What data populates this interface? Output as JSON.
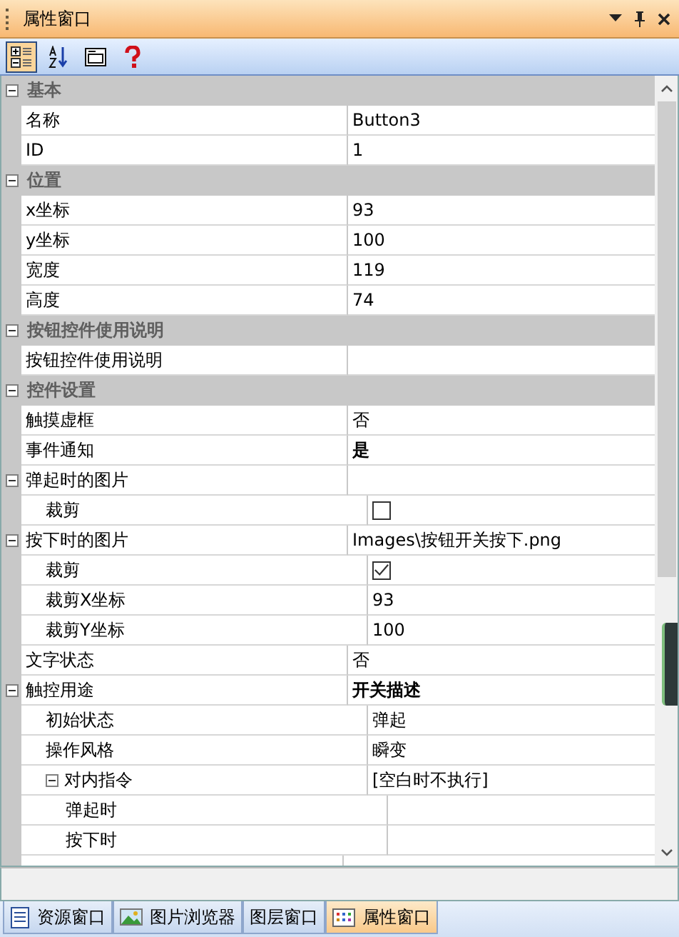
{
  "window": {
    "title": "属性窗口"
  },
  "toolbar": [
    {
      "kind": "categorized",
      "selected": true
    },
    {
      "kind": "alphabetical",
      "selected": false
    },
    {
      "kind": "pages",
      "selected": false
    },
    {
      "kind": "help",
      "selected": false
    }
  ],
  "grid": [
    {
      "kind": "category",
      "label": "基本",
      "expanded": true,
      "children": [
        {
          "kind": "text",
          "name": "名称",
          "value": "Button3"
        },
        {
          "kind": "text",
          "name": "ID",
          "value": "1"
        }
      ]
    },
    {
      "kind": "category",
      "label": "位置",
      "expanded": true,
      "children": [
        {
          "kind": "text",
          "name": "x坐标",
          "value": "93"
        },
        {
          "kind": "text",
          "name": "y坐标",
          "value": "100"
        },
        {
          "kind": "text",
          "name": "宽度",
          "value": "119"
        },
        {
          "kind": "text",
          "name": "高度",
          "value": "74"
        }
      ]
    },
    {
      "kind": "category",
      "label": "按钮控件使用说明",
      "expanded": true,
      "children": [
        {
          "kind": "text",
          "name": "按钮控件使用说明"
        }
      ]
    },
    {
      "kind": "category",
      "label": "控件设置",
      "expanded": true,
      "children": [
        {
          "kind": "text",
          "name": "触摸虚框",
          "value": "否"
        },
        {
          "kind": "text",
          "name": "事件通知",
          "value": "是",
          "bold": true
        },
        {
          "kind": "text",
          "name": "弹起时的图片",
          "expanded": true,
          "children": [
            {
              "kind": "checkbox",
              "name": "裁剪",
              "checked": false
            }
          ]
        },
        {
          "kind": "text",
          "name": "按下时的图片",
          "value": "Images\\按钮开关按下.png",
          "expanded": true,
          "children": [
            {
              "kind": "checkbox",
              "name": "裁剪",
              "checked": true
            },
            {
              "kind": "text",
              "name": "裁剪X坐标",
              "value": "93"
            },
            {
              "kind": "text",
              "name": "裁剪Y坐标",
              "value": "100"
            }
          ]
        },
        {
          "kind": "text",
          "name": "文字状态",
          "value": "否"
        },
        {
          "kind": "text",
          "name": "触控用途",
          "value": "开关描述",
          "bold": true,
          "expanded": true,
          "children": [
            {
              "kind": "text",
              "name": "初始状态",
              "value": "弹起"
            },
            {
              "kind": "text",
              "name": "操作风格",
              "value": "瞬变"
            },
            {
              "kind": "text",
              "name": "对内指令",
              "value": "[空白时不执行]",
              "expanded": true,
              "children": [
                {
                  "kind": "text",
                  "name": "弹起时"
                },
                {
                  "kind": "text",
                  "name": "按下时"
                }
              ]
            }
          ]
        }
      ]
    }
  ],
  "bottom_tabs": [
    {
      "label": "资源窗口",
      "kind": "document",
      "selected": false
    },
    {
      "label": "图片浏览器",
      "kind": "image",
      "selected": false
    },
    {
      "label": "图层窗口",
      "kind": "none",
      "selected": false
    },
    {
      "label": "属性窗口",
      "kind": "grid",
      "selected": true
    }
  ]
}
